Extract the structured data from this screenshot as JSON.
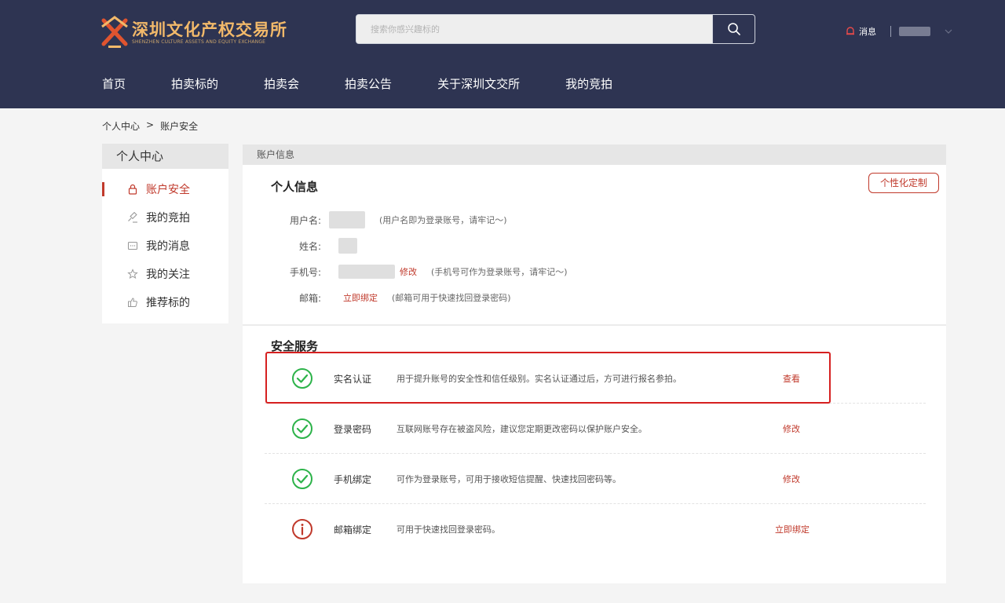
{
  "header": {
    "logo_cn": "深圳文化产权交易所",
    "logo_en": "SHENZHEN CULTURE ASSETS AND EQUITY EXCHANGE",
    "search_placeholder": "搜索你感兴趣标的",
    "messages_label": "消息"
  },
  "nav": {
    "items": [
      "首页",
      "拍卖标的",
      "拍卖会",
      "拍卖公告",
      "关于深圳文交所",
      "我的竞拍"
    ]
  },
  "breadcrumb": {
    "root": "个人中心",
    "separator": ">",
    "current": "账户安全"
  },
  "sidebar": {
    "title": "个人中心",
    "items": [
      {
        "label": "账户安全",
        "icon": "lock-icon",
        "active": true
      },
      {
        "label": "我的竞拍",
        "icon": "gavel-icon",
        "active": false
      },
      {
        "label": "我的消息",
        "icon": "message-icon",
        "active": false
      },
      {
        "label": "我的关注",
        "icon": "star-icon",
        "active": false
      },
      {
        "label": "推荐标的",
        "icon": "thumbs-up-icon",
        "active": false
      }
    ]
  },
  "main": {
    "header": "账户信息",
    "personal_title": "个人信息",
    "custom_button": "个性化定制",
    "info": {
      "username_label": "用户名:",
      "username_hint": "(用户名即为登录账号，请牢记～)",
      "name_label": "姓名:",
      "phone_label": "手机号:",
      "phone_action": "修改",
      "phone_hint": "(手机号可作为登录账号，请牢记～)",
      "email_label": "邮箱:",
      "email_action": "立即绑定",
      "email_hint": "(邮箱可用于快速找回登录密码)"
    },
    "security_title": "安全服务",
    "services": [
      {
        "name": "实名认证",
        "desc": "用于提升账号的安全性和信任级别。实名认证通过后，方可进行报名参拍。",
        "action": "查看",
        "status": "ok"
      },
      {
        "name": "登录密码",
        "desc": "互联网账号存在被盗风险，建议您定期更改密码以保护账户安全。",
        "action": "修改",
        "status": "ok"
      },
      {
        "name": "手机绑定",
        "desc": "可作为登录账号，可用于接收短信提醒、快速找回密码等。",
        "action": "修改",
        "status": "ok"
      },
      {
        "name": "邮箱绑定",
        "desc": "可用于快速找回登录密码。",
        "action": "立即绑定",
        "status": "warning"
      }
    ]
  },
  "colors": {
    "header_bg": "#2e3452",
    "accent_red": "#c0392b",
    "ok_green": "#2db34a",
    "warn_red": "#c0392b"
  }
}
